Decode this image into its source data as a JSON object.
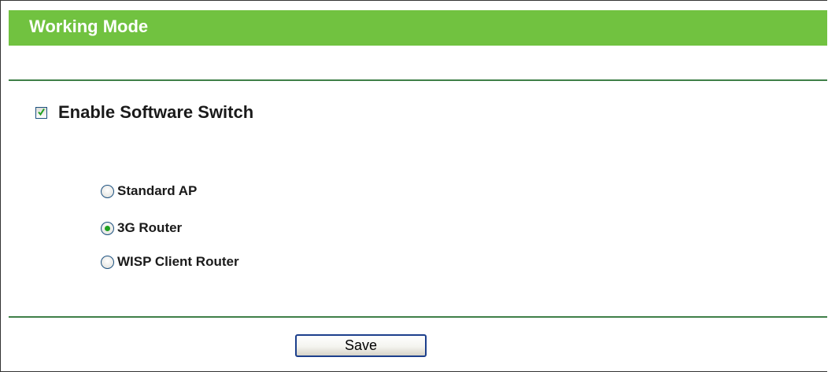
{
  "header": {
    "title": "Working Mode"
  },
  "software_switch": {
    "label": "Enable Software Switch",
    "checked": true
  },
  "modes": {
    "selected": "3G Router",
    "options": [
      {
        "label": "Standard AP",
        "selected": false
      },
      {
        "label": "3G Router",
        "selected": true
      },
      {
        "label": "WISP Client Router",
        "selected": false
      }
    ]
  },
  "actions": {
    "save_label": "Save"
  },
  "colors": {
    "header_bg": "#71c240",
    "divider": "#3f7f48",
    "radio_dot": "#21a121",
    "control_border": "#1c5180",
    "button_border": "#1c3f8c"
  },
  "icons": {
    "checkbox": "checkmark-icon",
    "radio": "radio-dot-icon"
  }
}
